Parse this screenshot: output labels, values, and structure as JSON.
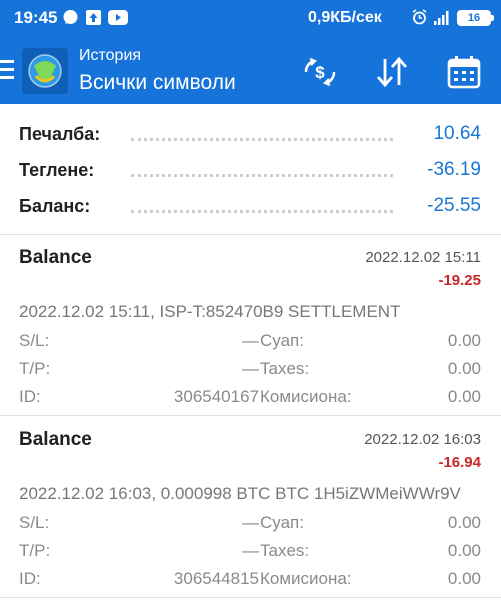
{
  "status_bar": {
    "time": "19:45",
    "net_speed": "0,9КБ/сек",
    "battery": "16",
    "icons_left": [
      "chat-icon",
      "upload-icon",
      "youtube-icon"
    ],
    "icons_right": [
      "alarm-icon",
      "signal-icon",
      "wifi-icon",
      "battery-icon"
    ]
  },
  "app_bar": {
    "subtitle": "История",
    "title": "Всички символи",
    "actions": [
      "dollar-exchange-icon",
      "sort-icon",
      "calendar-icon"
    ]
  },
  "summary": [
    {
      "label": "Печалба:",
      "value": "10.64"
    },
    {
      "label": "Теглене:",
      "value": "-36.19"
    },
    {
      "label": "Баланс:",
      "value": "-25.55"
    }
  ],
  "deals": [
    {
      "type": "Balance",
      "time": "2022.12.02 15:11",
      "amount": "-19.25",
      "comment": "2022.12.02 15:11, ISP-T:852470B9 SETTLEMENT",
      "sl_label": "S/L:",
      "sl_value": "—",
      "tp_label": "T/P:",
      "tp_value": "—",
      "id_label": "ID:",
      "id_value": "306540167",
      "swap_label": "Суап:",
      "swap_value": "0.00",
      "taxes_label": "Taxes:",
      "taxes_value": "0.00",
      "commission_label": "Комисиона:",
      "commission_value": "0.00"
    },
    {
      "type": "Balance",
      "time": "2022.12.02 16:03",
      "amount": "-16.94",
      "comment": "2022.12.02 16:03, 0.000998 BTC BTC 1H5iZWMeiWWr9V",
      "sl_label": "S/L:",
      "sl_value": "—",
      "tp_label": "T/P:",
      "tp_value": "—",
      "id_label": "ID:",
      "id_value": "306544815",
      "swap_label": "Суап:",
      "swap_value": "0.00",
      "taxes_label": "Taxes:",
      "taxes_value": "0.00",
      "commission_label": "Комисиона:",
      "commission_value": "0.00"
    }
  ],
  "colors": {
    "app_bar": "#1673d9",
    "positive_value": "#1976d2",
    "negative_amount": "#c62828"
  }
}
